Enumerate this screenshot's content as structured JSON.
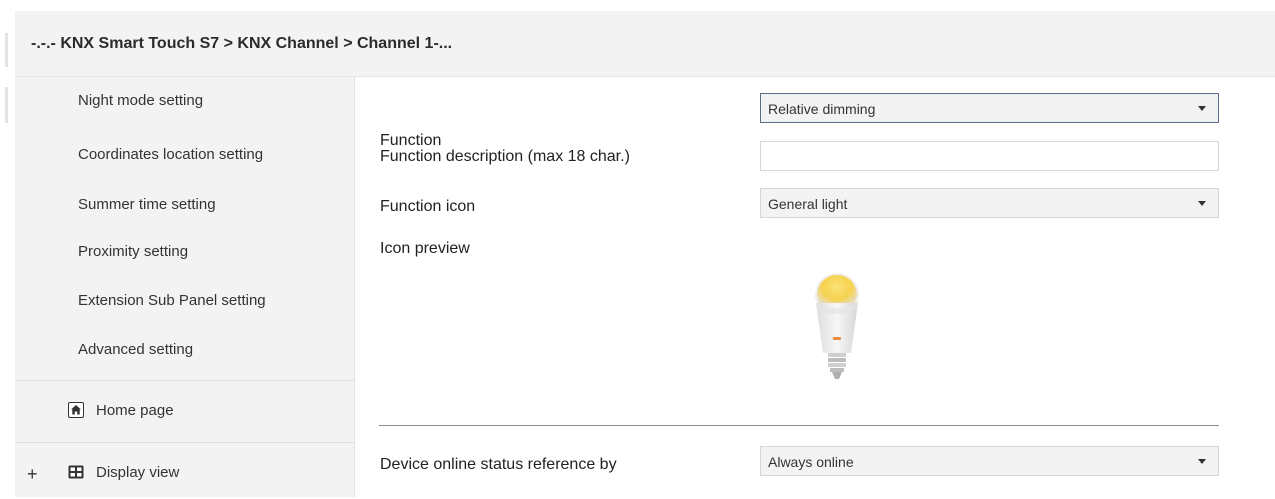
{
  "breadcrumb": "-.-.- KNX Smart Touch S7 > KNX Channel  > Channel 1-...",
  "sidebar": {
    "items": [
      {
        "label": "Night mode setting"
      },
      {
        "label": "Coordinates location setting"
      },
      {
        "label": "Summer time setting"
      },
      {
        "label": "Proximity setting"
      },
      {
        "label": "Extension Sub Panel setting"
      },
      {
        "label": "Advanced setting"
      }
    ],
    "sections": [
      {
        "label": "Home page",
        "icon": "home-icon",
        "expander": ""
      },
      {
        "label": "Display view",
        "icon": "grid-view-icon",
        "expander": "+"
      }
    ]
  },
  "params": {
    "function": {
      "label": "Function",
      "value": "Relative dimming"
    },
    "description": {
      "label": "Function description (max 18 char.)",
      "value": ""
    },
    "icon": {
      "label": "Function icon",
      "value": "General light"
    },
    "preview": {
      "label": "Icon preview",
      "icon": "light-bulb-icon"
    },
    "online_status": {
      "label": "Device online status reference by",
      "value": "Always online"
    }
  },
  "colors": {
    "panel_bg": "#f3f3f3",
    "active_border": "#5b6e8a",
    "bulb_glow": "#f7d55a",
    "bulb_indicator": "#f08a3c"
  }
}
